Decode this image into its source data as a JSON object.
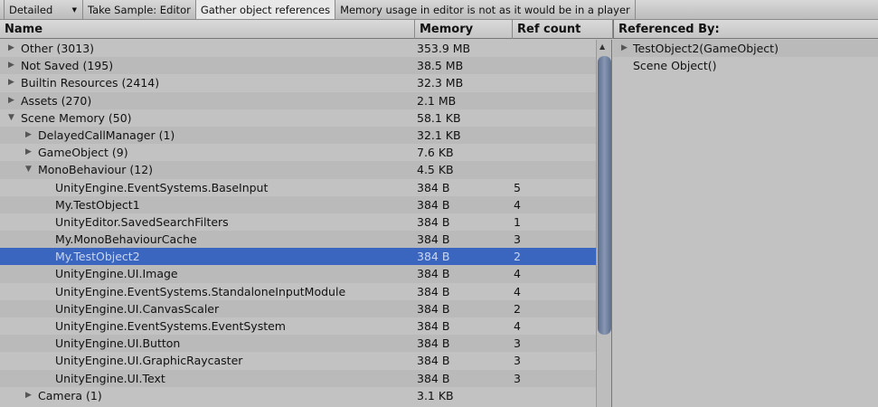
{
  "toolbar": {
    "mode": "Detailed",
    "take_sample": "Take Sample: Editor",
    "gather": "Gather object references",
    "warning": "Memory usage in editor is not as it would be in a player"
  },
  "columns": {
    "name": "Name",
    "memory": "Memory",
    "ref_count": "Ref count",
    "referenced_by": "Referenced By:"
  },
  "rows": [
    {
      "name": "Other (3013)",
      "memory": "353.9 MB",
      "ref": "",
      "level": 0,
      "arrow": "right"
    },
    {
      "name": "Not Saved (195)",
      "memory": "38.5 MB",
      "ref": "",
      "level": 0,
      "arrow": "right"
    },
    {
      "name": "Builtin Resources (2414)",
      "memory": "32.3 MB",
      "ref": "",
      "level": 0,
      "arrow": "right"
    },
    {
      "name": "Assets (270)",
      "memory": "2.1 MB",
      "ref": "",
      "level": 0,
      "arrow": "right"
    },
    {
      "name": "Scene Memory (50)",
      "memory": "58.1 KB",
      "ref": "",
      "level": 0,
      "arrow": "down"
    },
    {
      "name": "DelayedCallManager (1)",
      "memory": "32.1 KB",
      "ref": "",
      "level": 1,
      "arrow": "right"
    },
    {
      "name": "GameObject (9)",
      "memory": "7.6 KB",
      "ref": "",
      "level": 1,
      "arrow": "right"
    },
    {
      "name": "MonoBehaviour (12)",
      "memory": "4.5 KB",
      "ref": "",
      "level": 1,
      "arrow": "down"
    },
    {
      "name": "UnityEngine.EventSystems.BaseInput",
      "memory": "384 B",
      "ref": "5",
      "level": 2
    },
    {
      "name": "My.TestObject1",
      "memory": "384 B",
      "ref": "4",
      "level": 2
    },
    {
      "name": "UnityEditor.SavedSearchFilters",
      "memory": "384 B",
      "ref": "1",
      "level": 2
    },
    {
      "name": "My.MonoBehaviourCache",
      "memory": "384 B",
      "ref": "3",
      "level": 2
    },
    {
      "name": "My.TestObject2",
      "memory": "384 B",
      "ref": "2",
      "level": 2,
      "selected": true
    },
    {
      "name": "UnityEngine.UI.Image",
      "memory": "384 B",
      "ref": "4",
      "level": 2
    },
    {
      "name": "UnityEngine.EventSystems.StandaloneInputModule",
      "memory": "384 B",
      "ref": "4",
      "level": 2
    },
    {
      "name": "UnityEngine.UI.CanvasScaler",
      "memory": "384 B",
      "ref": "2",
      "level": 2
    },
    {
      "name": "UnityEngine.EventSystems.EventSystem",
      "memory": "384 B",
      "ref": "4",
      "level": 2
    },
    {
      "name": "UnityEngine.UI.Button",
      "memory": "384 B",
      "ref": "3",
      "level": 2
    },
    {
      "name": "UnityEngine.UI.GraphicRaycaster",
      "memory": "384 B",
      "ref": "3",
      "level": 2
    },
    {
      "name": "UnityEngine.UI.Text",
      "memory": "384 B",
      "ref": "3",
      "level": 2
    },
    {
      "name": "Camera (1)",
      "memory": "3.1 KB",
      "ref": "",
      "level": 1,
      "arrow": "right"
    }
  ],
  "referenced_by": [
    {
      "name": "TestObject2(GameObject)",
      "arrow": "right"
    },
    {
      "name": "Scene Object()"
    }
  ],
  "colors": {
    "selected": "#3b66c0"
  }
}
